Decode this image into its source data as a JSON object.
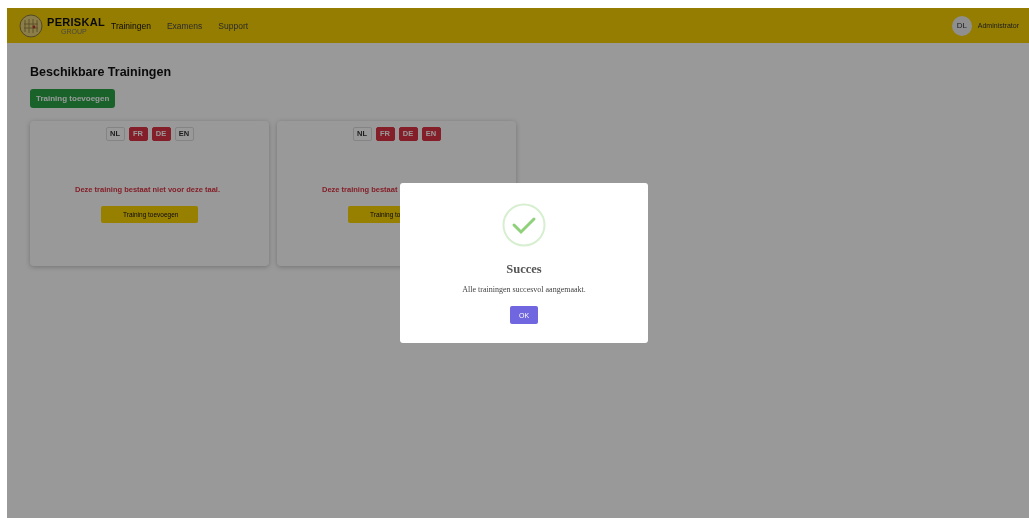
{
  "header": {
    "brand": "PERISKAL",
    "brand_sub": "GROUP",
    "nav": [
      {
        "label": "Trainingen",
        "selected": true
      },
      {
        "label": "Examens",
        "selected": false
      },
      {
        "label": "Support",
        "selected": false
      }
    ],
    "avatar": "DL",
    "user": "Administrator"
  },
  "page": {
    "title": "Beschikbare Trainingen",
    "add_button": "Training toevoegen"
  },
  "cards": [
    {
      "languages": [
        {
          "code": "NL",
          "available": true
        },
        {
          "code": "FR",
          "available": false
        },
        {
          "code": "DE",
          "available": false
        },
        {
          "code": "EN",
          "available": true
        }
      ],
      "message": "Deze training bestaat niet voor deze taal.",
      "button": "Training toevoegen"
    },
    {
      "languages": [
        {
          "code": "NL",
          "available": true
        },
        {
          "code": "FR",
          "available": false
        },
        {
          "code": "DE",
          "available": false
        },
        {
          "code": "EN",
          "available": false
        }
      ],
      "message": "Deze training bestaat",
      "button": "Training to"
    }
  ],
  "dialog": {
    "kind": "success",
    "title": "Succes",
    "message": "Alle trainingen succesvol aangemaakt.",
    "button": "OK"
  }
}
